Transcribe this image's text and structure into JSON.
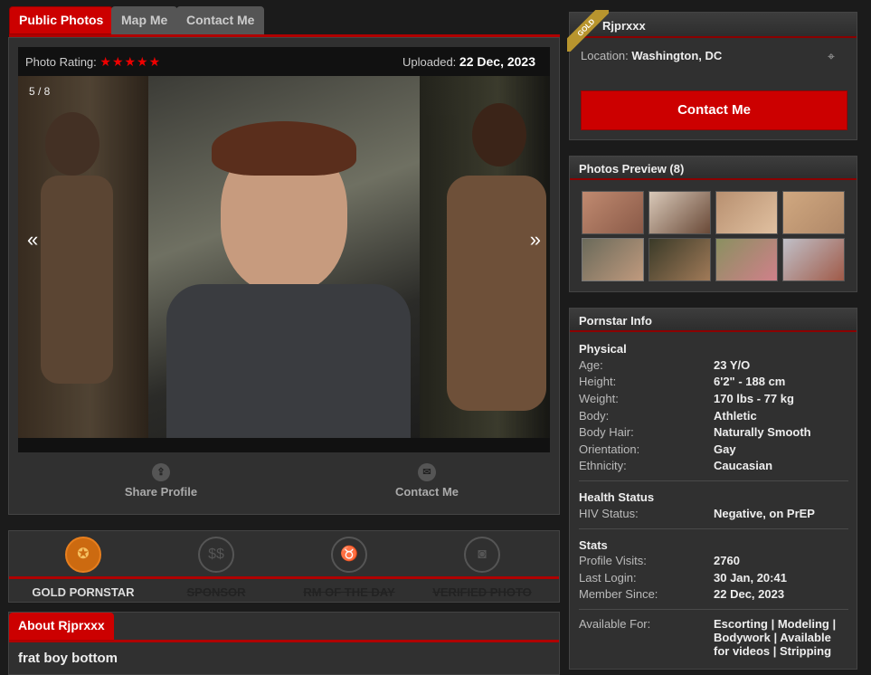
{
  "tabs": {
    "public_photos": "Public Photos",
    "map_me": "Map Me",
    "contact_me": "Contact Me"
  },
  "gallery": {
    "rating_label": "Photo Rating:",
    "stars": "★★★★★",
    "uploaded_label": "Uploaded:",
    "uploaded_date": "22 Dec, 2023",
    "counter": "5 / 8",
    "prev_arrow": "«",
    "next_arrow": "»",
    "share_label": "Share Profile",
    "contact_label": "Contact Me"
  },
  "badges": [
    {
      "label": "GOLD PORNSTAR",
      "icon": "medal-icon",
      "active": true
    },
    {
      "label": "SPONSOR",
      "icon": "dollar-icon",
      "active": false
    },
    {
      "label": "RM OF THE DAY",
      "icon": "bull-icon",
      "active": false
    },
    {
      "label": "VERIFIED PHOTO",
      "icon": "camera-icon",
      "active": false
    }
  ],
  "about": {
    "tab": "About Rjprxxx",
    "headline": "frat boy bottom"
  },
  "profile": {
    "ribbon": "GOLD",
    "name": "Rjprxxx",
    "location_label": "Location:",
    "location": "Washington, DC",
    "contact_button": "Contact Me"
  },
  "preview": {
    "title": "Photos Preview (8)"
  },
  "info": {
    "title": "Pornstar Info",
    "physical_title": "Physical",
    "age_k": "Age:",
    "age_v": "23 Y/O",
    "height_k": "Height:",
    "height_v": "6'2\" - 188 cm",
    "weight_k": "Weight:",
    "weight_v": "170 lbs - 77 kg",
    "body_k": "Body:",
    "body_v": "Athletic",
    "hair_k": "Body Hair:",
    "hair_v": "Naturally Smooth",
    "orient_k": "Orientation:",
    "orient_v": "Gay",
    "eth_k": "Ethnicity:",
    "eth_v": "Caucasian",
    "health_title": "Health Status",
    "hiv_k": "HIV Status:",
    "hiv_v": "Negative, on PrEP",
    "stats_title": "Stats",
    "visits_k": "Profile Visits:",
    "visits_v": "2760",
    "login_k": "Last Login:",
    "login_v": "30 Jan, 20:41",
    "since_k": "Member Since:",
    "since_v": "22 Dec, 2023",
    "avail_k": "Available For:",
    "avail_v": "Escorting | Modeling | Bodywork | Available for videos | Stripping"
  },
  "colors": {
    "accent": "#cc0000",
    "gold": "#b8952e",
    "badge_orange": "#cc6a10"
  }
}
